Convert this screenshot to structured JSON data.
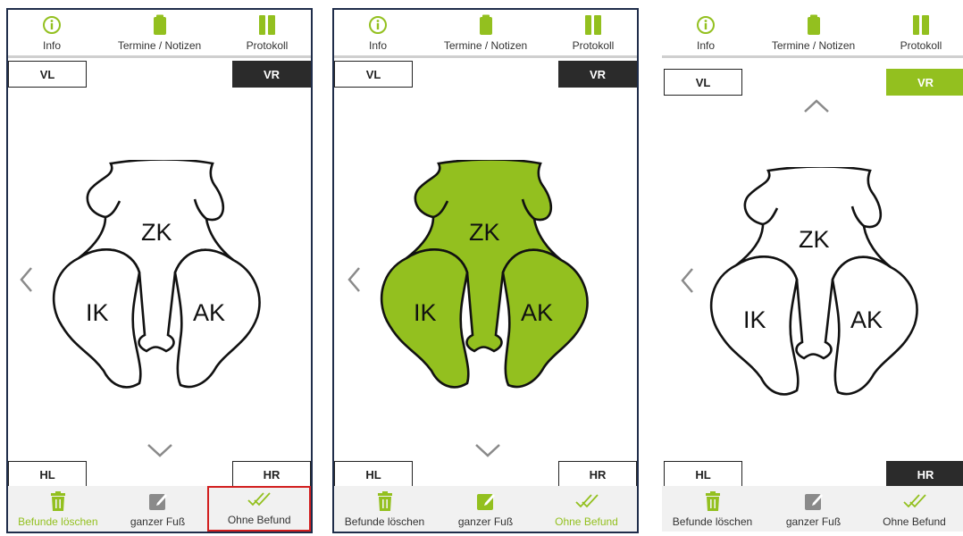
{
  "colors": {
    "accent_green": "#93c01f",
    "dark_button": "#2b2b2b",
    "highlight_red": "#d21e1e",
    "panel_border": "#1f2d4a",
    "bottom_bar": "#f1f1f1"
  },
  "panels": [
    {
      "tabs": [
        {
          "label": "Info",
          "icon": "info-circle-icon"
        },
        {
          "label": "Termine / Notizen",
          "icon": "clipboard-icon"
        },
        {
          "label": "Protokoll",
          "icon": "book-icon"
        }
      ],
      "corners": {
        "vl": "VL",
        "vr": "VR",
        "hl": "HL",
        "hr": "HR"
      },
      "active_corner": "VR",
      "active_style": "dark",
      "foot_filled": false,
      "foot_regions": {
        "zk": "ZK",
        "ik": "IK",
        "ak": "AK"
      },
      "bottom": [
        {
          "label": "Befunde löschen",
          "icon": "trash-icon"
        },
        {
          "label": "ganzer Fuß",
          "icon": "pencil-square-icon"
        },
        {
          "label": "Ohne Befund",
          "icon": "double-check-icon"
        }
      ],
      "highlighted_bottom": "Ohne Befund"
    },
    {
      "tabs": [
        {
          "label": "Info",
          "icon": "info-circle-icon"
        },
        {
          "label": "Termine / Notizen",
          "icon": "clipboard-icon"
        },
        {
          "label": "Protokoll",
          "icon": "book-icon"
        }
      ],
      "corners": {
        "vl": "VL",
        "vr": "VR",
        "hl": "HL",
        "hr": "HR"
      },
      "active_corner": "VR",
      "active_style": "dark",
      "foot_filled": true,
      "foot_regions": {
        "zk": "ZK",
        "ik": "IK",
        "ak": "AK"
      },
      "bottom": [
        {
          "label": "Befunde löschen",
          "icon": "trash-icon"
        },
        {
          "label": "ganzer Fuß",
          "icon": "pencil-square-icon"
        },
        {
          "label": "Ohne Befund",
          "icon": "double-check-icon"
        }
      ]
    },
    {
      "tabs": [
        {
          "label": "Info",
          "icon": "info-circle-icon"
        },
        {
          "label": "Termine / Notizen",
          "icon": "clipboard-icon"
        },
        {
          "label": "Protokoll",
          "icon": "book-icon"
        }
      ],
      "corners": {
        "vl": "VL",
        "vr": "VR",
        "hl": "HL",
        "hr": "HR"
      },
      "active_corner": "VR+HR",
      "active_style": "green-and-dark",
      "foot_filled": false,
      "foot_regions": {
        "zk": "ZK",
        "ik": "IK",
        "ak": "AK"
      },
      "bottom": [
        {
          "label": "Befunde löschen",
          "icon": "trash-icon"
        },
        {
          "label": "ganzer Fuß",
          "icon": "pencil-square-icon"
        },
        {
          "label": "Ohne Befund",
          "icon": "double-check-icon"
        }
      ]
    }
  ]
}
